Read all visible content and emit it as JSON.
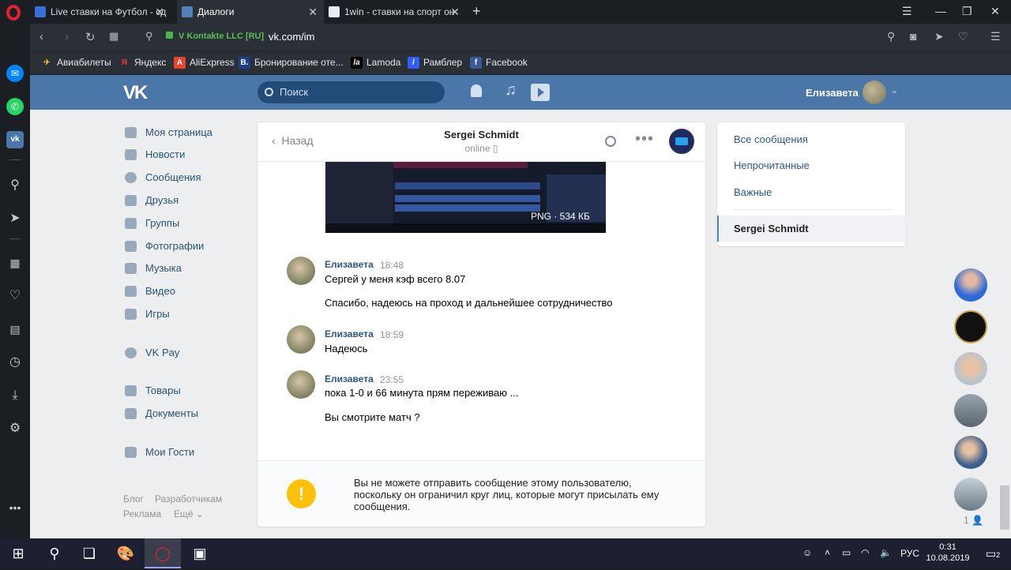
{
  "browser": {
    "tabs": [
      {
        "label": "Live ставки на Футбол - сд",
        "active": false
      },
      {
        "label": "Диалоги",
        "active": true
      },
      {
        "label": "1win - ставки на спорт он",
        "active": false
      }
    ],
    "new_tab_label": "+",
    "site_identity": "V Kontakte LLC [RU]",
    "url": "vk.com/im",
    "bookmarks": [
      "Авиабилеты",
      "Яндекс",
      "AliExpress",
      "Бронирование оте...",
      "Lamoda",
      "Рамблер",
      "Facebook"
    ],
    "bookmark_icons": [
      "✈",
      "Я",
      "A",
      "B.",
      "la",
      "/",
      "f"
    ]
  },
  "vk": {
    "search_placeholder": "Поиск",
    "user_name": "Елизавета",
    "nav": [
      {
        "label": "Моя страница",
        "icon": "home-icon"
      },
      {
        "label": "Новости",
        "icon": "news-icon"
      },
      {
        "label": "Сообщения",
        "icon": "messages-icon"
      },
      {
        "label": "Друзья",
        "icon": "friends-icon"
      },
      {
        "label": "Группы",
        "icon": "groups-icon"
      },
      {
        "label": "Фотографии",
        "icon": "camera-icon"
      },
      {
        "label": "Музыка",
        "icon": "music-icon"
      },
      {
        "label": "Видео",
        "icon": "video-icon"
      },
      {
        "label": "Игры",
        "icon": "games-icon"
      },
      {
        "label": "VK Pay",
        "icon": "vkpay-icon"
      },
      {
        "label": "Товары",
        "icon": "bag-icon"
      },
      {
        "label": "Документы",
        "icon": "document-icon"
      },
      {
        "label": "Мои Гости",
        "icon": "guests-icon"
      }
    ],
    "footer": {
      "blog": "Блог",
      "dev": "Разработчикам",
      "ads": "Реклама",
      "more": "Ещё ⌄"
    },
    "chat": {
      "back_label": "Назад",
      "name": "Sergei Schmidt",
      "status": "online",
      "attachment_label": "PNG · 534 КБ",
      "messages": [
        {
          "author": "Елизавета",
          "time": "18:48",
          "lines": [
            "Сергей у меня кэф всего 8.07",
            "Спасибо, надеюсь на проход и дальнейшее сотрудничество"
          ]
        },
        {
          "author": "Елизавета",
          "time": "18:59",
          "lines": [
            "Надеюсь"
          ]
        },
        {
          "author": "Елизавета",
          "time": "23:55",
          "lines": [
            "пока 1-0 и 66 минута прям переживаю ...",
            "Вы смотрите матч ?"
          ]
        }
      ],
      "notice_icon": "!",
      "notice": "Вы не можете отправить сообщение этому пользователю, поскольку он ограничил круг лиц, которые могут присылать ему сообщения."
    },
    "filters": [
      "Все сообщения",
      "Непрочитанные",
      "Важные"
    ],
    "active_dialog": "Sergei Schmidt",
    "friends_online_count": "1"
  },
  "taskbar": {
    "lang": "РУС",
    "time": "0:31",
    "date": "10.08.2019",
    "notifications": "2"
  },
  "colors": {
    "vk_header": "#4a76a8",
    "vk_link": "#2a5885",
    "warning": "#ffc107",
    "opera_red": "#e3232c"
  }
}
